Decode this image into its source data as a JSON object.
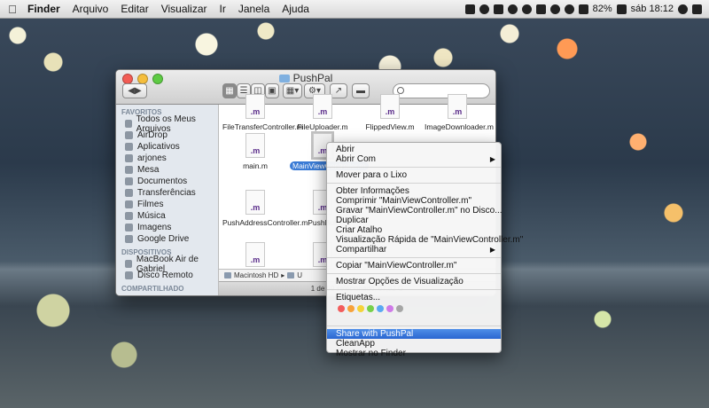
{
  "menubar": {
    "apple": "",
    "items": [
      "Finder",
      "Arquivo",
      "Editar",
      "Visualizar",
      "Ir",
      "Janela",
      "Ajuda"
    ],
    "battery": "82%",
    "clock": "sáb 18:12"
  },
  "finder": {
    "title": "PushPal",
    "sidebar": {
      "favorites_header": "FAVORITOS",
      "favorites": [
        "Todos os Meus Arquivos",
        "AirDrop",
        "Aplicativos",
        "arjones",
        "Mesa",
        "Documentos",
        "Transferências",
        "Filmes",
        "Música",
        "Imagens",
        "Google Drive"
      ],
      "devices_header": "DISPOSITIVOS",
      "devices": [
        "MacBook Air de Gabriel",
        "Disco Remoto"
      ],
      "shared_header": "COMPARTILHADO"
    },
    "files": [
      {
        "name": "FileTransferController.m",
        "ext": ".m"
      },
      {
        "name": "FileUploader.m",
        "ext": ".m"
      },
      {
        "name": "FlippedView.m",
        "ext": ".m"
      },
      {
        "name": "ImageDownloader.m",
        "ext": ".m"
      },
      {
        "name": "main.m",
        "ext": ".m"
      },
      {
        "name": "MainViewController.m",
        "ext": ".m",
        "selected": true
      },
      {
        "name": "PushAddressController.m",
        "ext": ".m"
      },
      {
        "name": "PushBull",
        "ext": ".m"
      },
      {
        "name": "",
        "ext": ".m"
      },
      {
        "name": "",
        "ext": ".m"
      }
    ],
    "path": [
      "Macintosh HD",
      "U"
    ],
    "status": "1 de 59 selecionado, 67,82 G"
  },
  "context_menu": {
    "group1": [
      "Abrir",
      "Abrir Com"
    ],
    "group2": [
      "Mover para o Lixo"
    ],
    "group3": [
      "Obter Informações",
      "Comprimir \"MainViewController.m\"",
      "Gravar \"MainViewController.m\" no Disco...",
      "Duplicar",
      "Criar Atalho",
      "Visualização Rápida de \"MainViewController.m\"",
      "Compartilhar"
    ],
    "group4": [
      "Copiar \"MainViewController.m\""
    ],
    "group5": [
      "Mostrar Opções de Visualização"
    ],
    "tags_label": "Etiquetas...",
    "tag_colors": [
      "#f25c5c",
      "#f7a23b",
      "#f5d33a",
      "#77d04a",
      "#5aa8f2",
      "#cf7ae8",
      "#a6a6a6"
    ],
    "group6": [
      "Share with PushPal",
      "CleanApp",
      "Mostrar no Finder"
    ],
    "highlighted": "Share with PushPal"
  }
}
